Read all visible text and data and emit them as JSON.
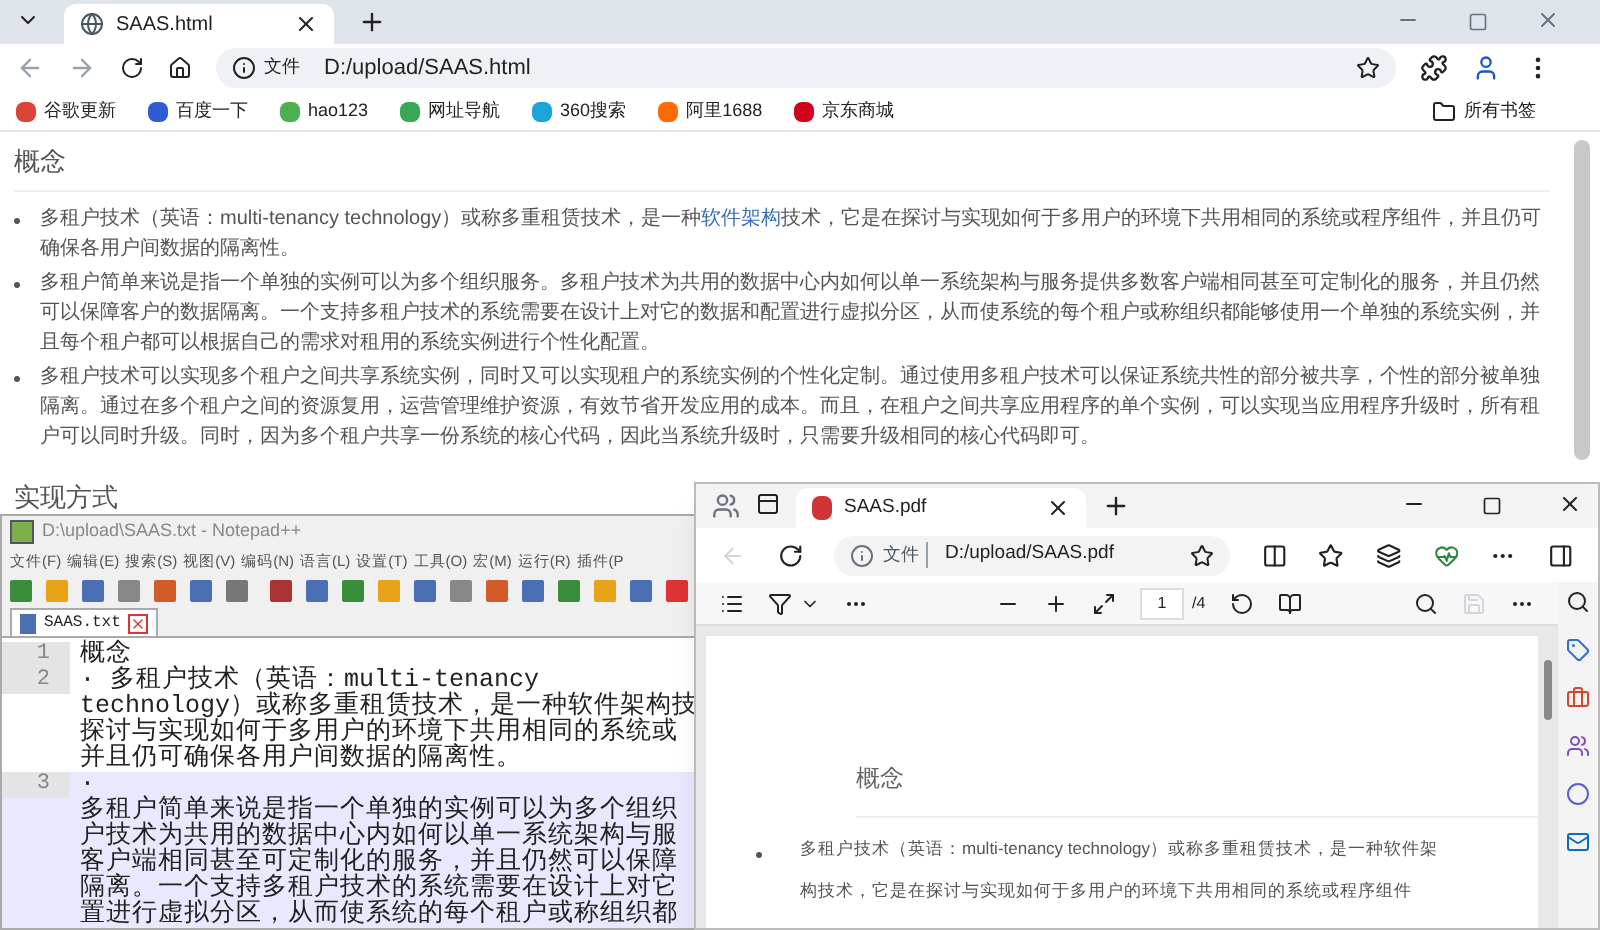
{
  "chrome": {
    "tab_title": "SAAS.html",
    "address": {
      "scheme_label": "文件",
      "url": "D:/upload/SAAS.html"
    },
    "bookmarks": [
      "谷歌更新",
      "百度一下",
      "hao123",
      "网址导航",
      "360搜索",
      "阿里1688",
      "京东商城"
    ],
    "all_bookmarks": "所有书签"
  },
  "page": {
    "sections": [
      {
        "heading": "概念",
        "bullets": [
          [
            {
              "text": "多租户技术（英语：multi-tenancy technology）或称多重租赁技术，是一种"
            },
            {
              "text": "软件架构",
              "link": true
            },
            {
              "text": "技术，它是在探讨与实现如何于多用户的环境下共用相同的系统或程序组件，并且仍可确保各用户间数据的隔离性。"
            }
          ],
          [
            {
              "text": "多租户简单来说是指一个单独的实例可以为多个组织服务。多租户技术为共用的数据中心内如何以单一系统架构与服务提供多数客户端相同甚至可定制化的服务，并且仍然可以保障客户的数据隔离。一个支持多租户技术的系统需要在设计上对它的数据和配置进行虚拟分区，从而使系统的每个租户或称组织都能够使用一个单独的系统实例，并且每个租户都可以根据自己的需求对租用的系统实例进行个性化配置。"
            }
          ],
          [
            {
              "text": "多租户技术可以实现多个租户之间共享系统实例，同时又可以实现租户的系统实例的个性化定制。通过使用多租户技术可以保证系统共性的部分被共享，个性的部分被单独隔离。通过在多个租户之间的资源复用，运营管理维护资源，有效节省开发应用的成本。而且，在租户之间共享应用程序的单个实例，可以实现当应用程序升级时，所有租户可以同时升级。同时，因为多个租户共享一份系统的核心代码，因此当系统升级时，只需要升级相同的核心代码即可。"
            }
          ]
        ]
      },
      {
        "heading": "实现方式"
      }
    ]
  },
  "notepad": {
    "title": "D:\\upload\\SAAS.txt - Notepad++",
    "menu": [
      "文件(F)",
      "编辑(E)",
      "搜索(S)",
      "视图(V)",
      "编码(N)",
      "语言(L)",
      "设置(T)",
      "工具(O)",
      "宏(M)",
      "运行(R)",
      "插件(P"
    ],
    "tab": "SAAS.txt",
    "lines": [
      {
        "number": "1",
        "selected": false,
        "rows": [
          "概念"
        ]
      },
      {
        "number": "2",
        "selected": false,
        "rows": [
          "· 多租户技术（英语：multi-tenancy",
          "technology）或称多重租赁技术，是一种软件架构技",
          "探讨与实现如何于多用户的环境下共用相同的系统或",
          "并且仍可确保各用户间数据的隔离性。"
        ]
      },
      {
        "number": "3",
        "selected": true,
        "rows": [
          "·",
          "多租户简单来说是指一个单独的实例可以为多个组织",
          "户技术为共用的数据中心内如何以单一系统架构与服",
          "客户端相同甚至可定制化的服务，并且仍然可以保障",
          "隔离。一个支持多租户技术的系统需要在设计上对它",
          "置进行虚拟分区，从而使系统的每个租户或称组织都"
        ]
      }
    ]
  },
  "edge": {
    "tab_title": "SAAS.pdf",
    "address": {
      "scheme_label": "文件",
      "url": "D:/upload/SAAS.pdf"
    },
    "pdf_toolbar": {
      "page": "1",
      "total": "/4"
    },
    "pdf_page": {
      "heading": "概念",
      "bullet_rows": [
        "多租户技术（英语：multi-tenancy technology）或称多重租赁技术，是一种软件架",
        "构技术，它是在探讨与实现如何于多用户的环境下共用相同的系统或程序组件"
      ]
    }
  }
}
